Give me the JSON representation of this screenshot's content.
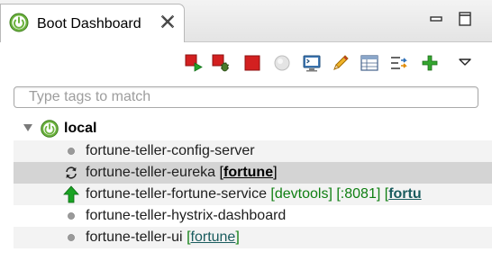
{
  "tab": {
    "title": "Boot Dashboard"
  },
  "toolbar": {
    "icons": [
      "start-icon",
      "debug-icon",
      "stop-icon",
      "open-browser-icon",
      "console-icon",
      "edit-tags-icon",
      "properties-icon",
      "filter-icon",
      "add-icon",
      "view-menu-icon"
    ]
  },
  "search": {
    "placeholder": "Type tags to match",
    "value": ""
  },
  "tree": {
    "root": {
      "label": "local"
    },
    "rows": [
      {
        "name": "fortune-teller-config-server",
        "status": "stopped",
        "extra": []
      },
      {
        "name": "fortune-teller-eureka",
        "status": "starting",
        "selected": true,
        "extra": [
          {
            "open": "[",
            "link": "fortune",
            "close": "]"
          }
        ]
      },
      {
        "name": "fortune-teller-fortune-service",
        "status": "running",
        "devtools": "[devtools]",
        "port": "[:8081]",
        "tag_open": "[",
        "tag_link": "fortu"
      },
      {
        "name": "fortune-teller-hystrix-dashboard",
        "status": "stopped",
        "extra": []
      },
      {
        "name": "fortune-teller-ui",
        "status": "stopped",
        "extra": [
          {
            "open": "[",
            "link": "fortune",
            "close": "]"
          }
        ]
      }
    ]
  },
  "colors": {
    "tag_green": "#0f7f12",
    "link_teal": "#1a5c5e",
    "spring_green": "#6db33f",
    "stop_red": "#d32020",
    "run_green": "#1aa323"
  }
}
